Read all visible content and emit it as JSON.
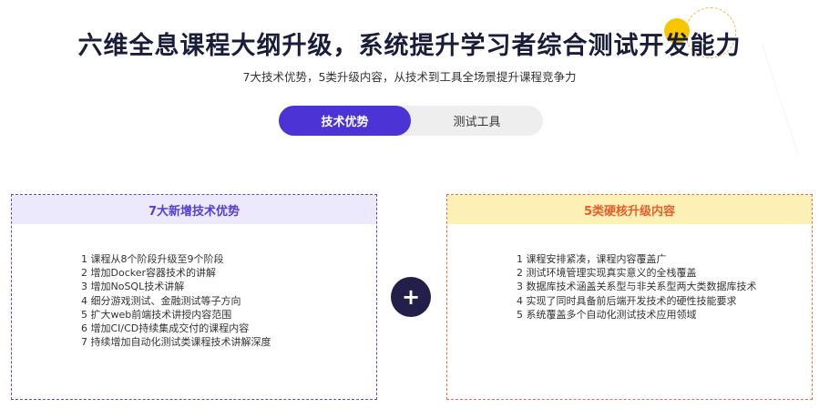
{
  "header": {
    "title": "六维全息课程大纲升级，系统提升学习者综合测试开发能力",
    "subtitle": "7大技术优势，5类升级内容，从技术到工具全场景提升课程竞争力"
  },
  "tabs": [
    {
      "label": "技术优势",
      "active": true
    },
    {
      "label": "测试工具",
      "active": false
    }
  ],
  "left_panel": {
    "title": "7大新增技术优势",
    "items": [
      "1 课程从8个阶段升级至9个阶段",
      "2 增加Docker容器技术的讲解",
      "3 增加NoSQL技术讲解",
      "4 细分游戏测试、金融测试等子方向",
      "5 扩大web前端技术讲授内容范围",
      "6 增加CI/CD持续集成交付的课程内容",
      "7 持续增加自动化测试类课程技术讲解深度"
    ]
  },
  "right_panel": {
    "title": "5类硬核升级内容",
    "items": [
      "1 课程安排紧凑，课程内容覆盖广",
      "2 测试环境管理实现真实意义的全栈覆盖",
      "3 数据库技术涵盖关系型与非关系型两大类数据库技术",
      "4 实现了同时具备前后端开发技术的硬性技能要求",
      "5 系统覆盖多个自动化测试技术应用领域"
    ]
  },
  "connector": {
    "symbol": "+"
  },
  "colors": {
    "accent": "#4b33d6",
    "left_border": "#5a4fc9",
    "right_border": "#e0724b",
    "left_head_bg": "#ece9fd",
    "right_head_bg": "#fdf0b4",
    "plus_bg": "#22204a"
  }
}
